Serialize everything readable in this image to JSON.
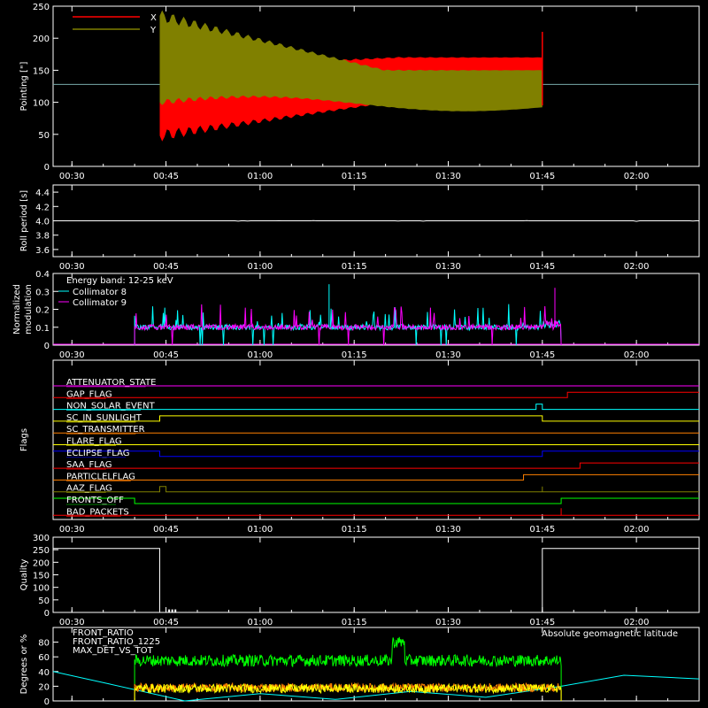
{
  "time_ticks": [
    "00:30",
    "00:45",
    "01:00",
    "01:15",
    "01:30",
    "01:45",
    "02:00"
  ],
  "chart_data": [
    {
      "type": "line",
      "panel": "pointing",
      "ylabel": "Pointing [\"]",
      "ylim": [
        0,
        250
      ],
      "yticks": [
        "0",
        "50",
        "100",
        "150",
        "200",
        "250"
      ],
      "xlim": [
        "00:27",
        "02:10"
      ],
      "legend_placement": "top-left",
      "series": [
        {
          "name": "X",
          "color": "#ff0000",
          "note_values": "oscillating band",
          "start": "00:44",
          "end": "01:45",
          "min_start": 48,
          "max_start": 152,
          "min_end": 110,
          "max_end": 170
        },
        {
          "name": "Y",
          "color": "#808000",
          "start": "00:44",
          "end": "01:45",
          "min_start": 100,
          "max_start": 235,
          "min_end": 95,
          "max_end": 150
        }
      ],
      "baseline": 128
    },
    {
      "type": "line",
      "panel": "roll",
      "ylabel": "Roll period [s]",
      "ylim": [
        3.5,
        4.5
      ],
      "yticks": [
        "3.6",
        "3.8",
        "4.0",
        "4.2",
        "4.4"
      ],
      "series": [
        {
          "name": "",
          "color": "#ffffff",
          "value": 4.0
        }
      ]
    },
    {
      "type": "line",
      "panel": "modulation",
      "ylabel": "Normalized modulation",
      "ylim": [
        0,
        0.4
      ],
      "yticks": [
        "0",
        "0.1",
        "0.2",
        "0.3",
        "0.4"
      ],
      "annotation": "Energy band: 12-25 keV",
      "series": [
        {
          "name": "Collimator 8",
          "color": "#00ffff",
          "start": "00:40",
          "end": "01:48",
          "typical": 0.1
        },
        {
          "name": "Collimator 9",
          "color": "#ff00ff",
          "start": "00:40",
          "end": "01:48",
          "typical": 0.1
        }
      ]
    },
    {
      "type": "line",
      "panel": "flags",
      "ylabel": "Flags",
      "flags": [
        {
          "name": "ATTENUATOR_STATE",
          "color": "#ff00ff",
          "transitions": []
        },
        {
          "name": "GAP_FLAG",
          "color": "#ff0000",
          "transitions": [
            {
              "t": "01:49",
              "level": 1
            }
          ]
        },
        {
          "name": "NON_SOLAR_EVENT",
          "color": "#00ffff",
          "transitions": [
            {
              "t": "01:44",
              "level": 1
            },
            {
              "t": "01:45",
              "level": 0
            }
          ]
        },
        {
          "name": "SC_IN_SUNLIGHT",
          "color": "#ffff00",
          "transitions": [
            {
              "t": "00:44",
              "level": 1
            },
            {
              "t": "01:45",
              "level": 0
            }
          ]
        },
        {
          "name": "SC_TRANSMITTER",
          "color": "#ff8000",
          "transitions": []
        },
        {
          "name": "FLARE_FLAG",
          "color": "#ffff00",
          "transitions": []
        },
        {
          "name": "ECLIPSE_FLAG",
          "color": "#0000ff",
          "transitions": [
            {
              "t": "00:44",
              "level": 0
            },
            {
              "t": "01:45",
              "level": 1
            }
          ]
        },
        {
          "name": "SAA_FLAG",
          "color": "#ff0000",
          "transitions": [
            {
              "t": "01:51",
              "level": 1
            }
          ]
        },
        {
          "name": "PARTICLELFLAG",
          "color": "#ff8000",
          "transitions": [
            {
              "t": "01:42",
              "level": 1
            }
          ]
        },
        {
          "name": "AAZ_FLAG",
          "color": "#808000",
          "transitions": [
            {
              "t": "00:44",
              "level": 1
            },
            {
              "t": "00:45",
              "level": 0
            },
            {
              "t": "01:45",
              "level": 1
            },
            {
              "t": "01:45",
              "level": 0
            }
          ]
        },
        {
          "name": "FRONTS_OFF",
          "color": "#00ff00",
          "transitions": [
            {
              "t": "00:40",
              "level": 0
            },
            {
              "t": "01:48",
              "level": 1
            }
          ]
        },
        {
          "name": "BAD_PACKETS",
          "color": "#ff0000",
          "transitions": [
            {
              "t": "01:48",
              "spike": true
            }
          ]
        }
      ]
    },
    {
      "type": "line",
      "panel": "quality",
      "ylabel": "Quality",
      "ylim": [
        0,
        300
      ],
      "yticks": [
        "0",
        "50",
        "100",
        "150",
        "200",
        "250",
        "300"
      ],
      "series": [
        {
          "name": "",
          "color": "#ffffff",
          "segments": [
            {
              "from": "00:27",
              "to": "00:44",
              "value": 255
            },
            {
              "from": "00:44",
              "to": "01:45",
              "value": 0
            },
            {
              "from": "01:45",
              "to": "02:10",
              "value": 255
            }
          ]
        }
      ]
    },
    {
      "type": "line",
      "panel": "ratios",
      "ylabel": "Degrees or %",
      "ylim": [
        0,
        100
      ],
      "yticks": [
        "0",
        "20",
        "40",
        "60",
        "80"
      ],
      "annotation": "Absolute geomagnetic latitude",
      "annotation_color": "#00ffff",
      "series": [
        {
          "name": "FRONT_RATIO",
          "color": "#ffff00",
          "start": "00:40",
          "end": "01:48",
          "typical": 17
        },
        {
          "name": "FRONT_RATIO_1225",
          "color": "#00ff00",
          "start": "00:40",
          "end": "01:48",
          "typical": 55,
          "plateau": {
            "from": "01:21",
            "to": "01:23",
            "value": 80
          }
        },
        {
          "name": "MAX_DET_VS_TOT",
          "color": "#ff8000",
          "start": "00:40",
          "end": "01:48",
          "typical": 18
        },
        {
          "name": "",
          "color": "#00ffff",
          "note_values": "geomagnetic latitude curve",
          "points": [
            [
              "00:27",
              40
            ],
            [
              "00:36",
              23
            ],
            [
              "00:48",
              0
            ],
            [
              "01:00",
              10
            ],
            [
              "01:12",
              2
            ],
            [
              "01:24",
              13
            ],
            [
              "01:36",
              5
            ],
            [
              "01:48",
              20
            ],
            [
              "01:58",
              35
            ],
            [
              "02:10",
              30
            ]
          ]
        }
      ]
    }
  ]
}
